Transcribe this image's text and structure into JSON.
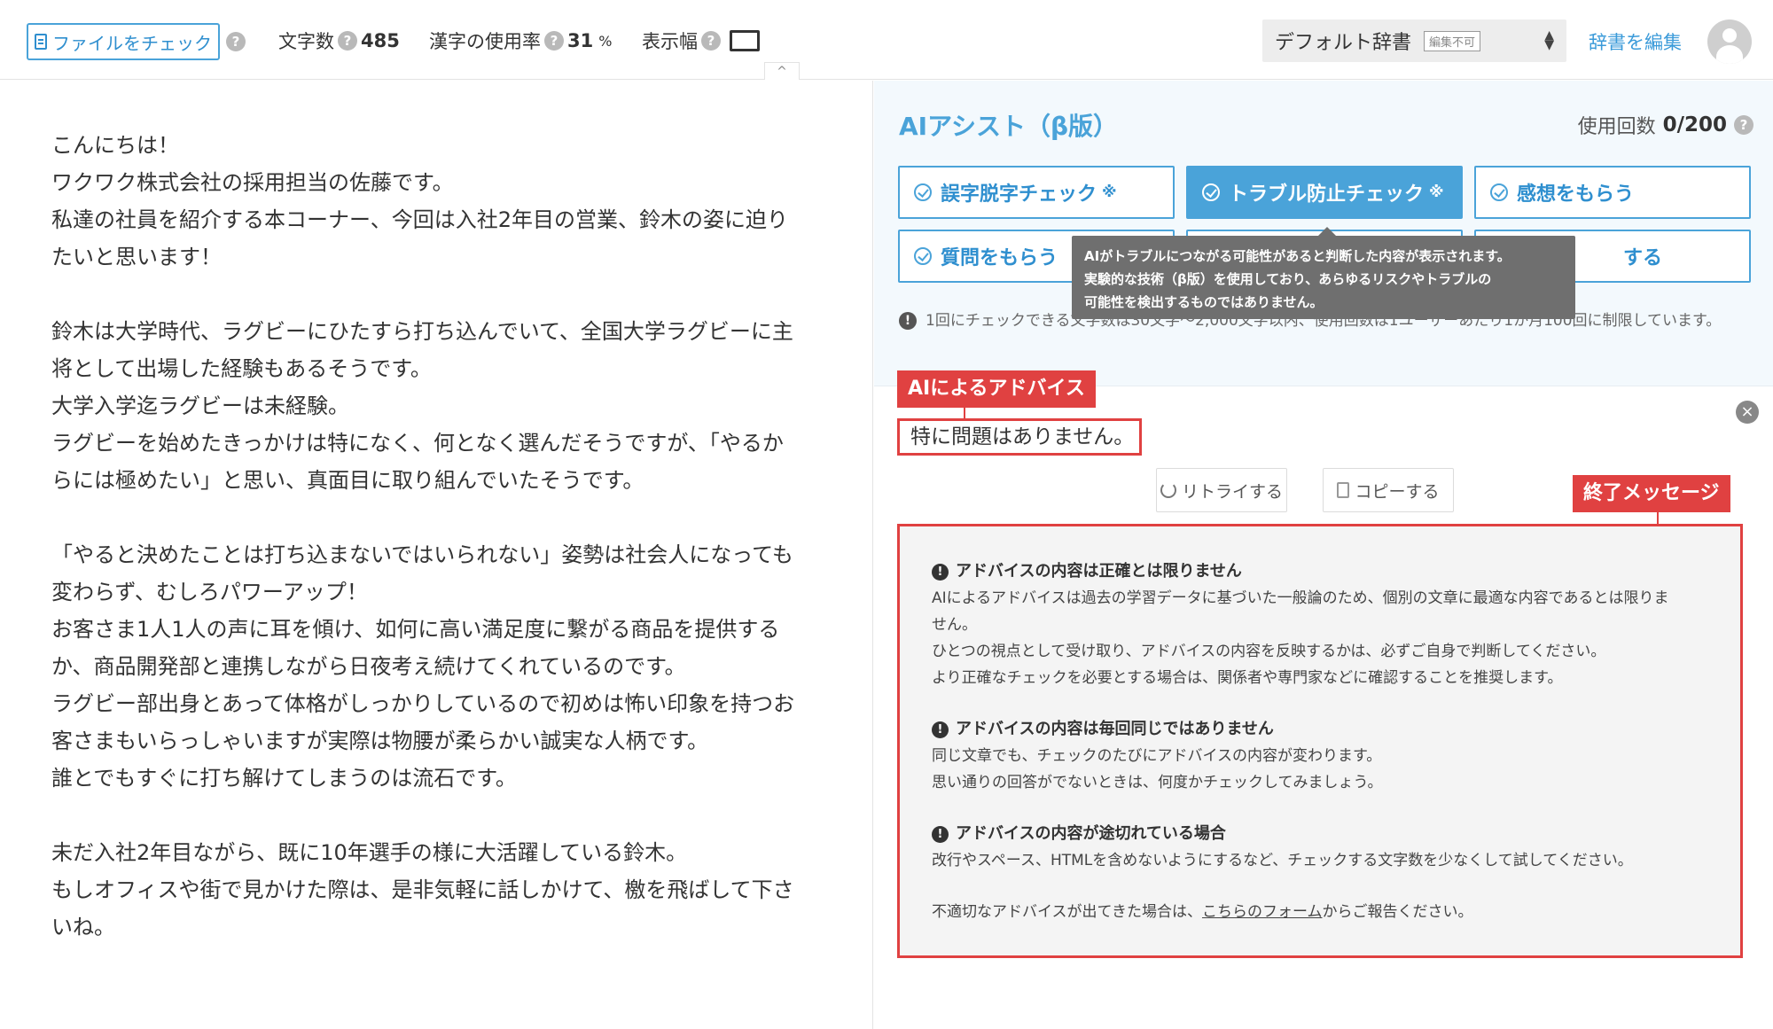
{
  "toolbar": {
    "file_check_label": "ファイルをチェック",
    "char_count_label": "文字数",
    "char_count_value": "485",
    "kanji_rate_label": "漢字の使用率",
    "kanji_rate_value": "31",
    "kanji_rate_unit": "%",
    "display_width_label": "表示幅",
    "dictionary": "デフォルト辞書",
    "dictionary_badge": "編集不可",
    "edit_dictionary": "辞書を編集",
    "collapse": "^"
  },
  "editor": {
    "lines": [
      "こんにちは！",
      "ワクワク株式会社の採用担当の佐藤です。",
      "私達の社員を紹介する本コーナー、今回は入社2年目の営業、鈴木の姿に迫り",
      "たいと思います！",
      "",
      "鈴木は大学時代、ラグビーにひたすら打ち込んでいて、全国大学ラグビーに主",
      "将として出場した経験もあるそうです。",
      "大学入学迄ラグビーは未経験。",
      "ラグビーを始めたきっかけは特になく、何となく選んだそうですが、「やるか",
      "らには極めたい」と思い、真面目に取り組んでいたそうです。",
      "",
      "「やると決めたことは打ち込まないではいられない」姿勢は社会人になっても",
      "変わらず、むしろパワーアップ！",
      "お客さま1人1人の声に耳を傾け、如何に高い満足度に繋がる商品を提供する",
      "か、商品開発部と連携しながら日夜考え続けてくれているのです。",
      "ラグビー部出身とあって体格がしっかりしているので初めは怖い印象を持つお",
      "客さまもいらっしゃいますが実際は物腰が柔らかい誠実な人柄です。",
      "誰とでもすぐに打ち解けてしまうのは流石です。",
      "",
      "未だ入社2年目ながら、既に10年選手の様に大活躍している鈴木。",
      "もしオフィスや街で見かけた際は、是非気軽に話しかけて、檄を飛ばして下さ",
      "いね。"
    ]
  },
  "ai": {
    "title": "AIアシスト（β版）",
    "usage_label": "使用回数",
    "usage_value": "0/200",
    "buttons": [
      {
        "label": "誤字脱字チェック",
        "mark": "※"
      },
      {
        "label": "トラブル防止チェック",
        "mark": "※"
      },
      {
        "label": "感想をもらう",
        "mark": ""
      },
      {
        "label": "質問をもらう",
        "mark": ""
      },
      {
        "label": "",
        "mark": ""
      },
      {
        "label": "する",
        "mark": ""
      }
    ],
    "note": "1回にチェックできる文字数は30文字〜2,000文字以内、使用回数は1ユーザーあたり1か月100回に制限しています。",
    "tooltip": [
      "AIがトラブルにつながる可能性があると判断した内容が表示されます。",
      "実験的な技術（β版）を使用しており、あらゆるリスクやトラブルの",
      "可能性を検出するものではありません。"
    ]
  },
  "result": {
    "advice_label": "AIによるアドバイス",
    "advice_text": "特に問題はありません。",
    "retry": "リトライする",
    "copy": "コピーする",
    "end_label": "終了メッセージ",
    "sections": [
      {
        "heading": "アドバイスの内容は正確とは限りません",
        "body": [
          "AIによるアドバイスは過去の学習データに基づいた一般論のため、個別の文章に最適な内容であるとは限りま",
          "せん。",
          "ひとつの視点として受け取り、アドバイスの内容を反映するかは、必ずご自身で判断してください。",
          "より正確なチェックを必要とする場合は、関係者や専門家などに確認することを推奨します。"
        ]
      },
      {
        "heading": "アドバイスの内容は毎回同じではありません",
        "body": [
          "同じ文章でも、チェックのたびにアドバイスの内容が変わります。",
          "思い通りの回答がでないときは、何度かチェックしてみましょう。"
        ]
      },
      {
        "heading": "アドバイスの内容が途切れている場合",
        "body": [
          "改行やスペース、HTMLを含めないようにするなど、チェックする文字数を少なくして試してください。"
        ]
      }
    ],
    "footer_prefix": "不適切なアドバイスが出てきた場合は、",
    "footer_link": "こちらのフォーム",
    "footer_suffix": "からご報告ください。"
  },
  "colors": {
    "accent": "#4aa3d9",
    "highlight_red": "#e04141",
    "panel_bg": "#f3f9fd"
  }
}
